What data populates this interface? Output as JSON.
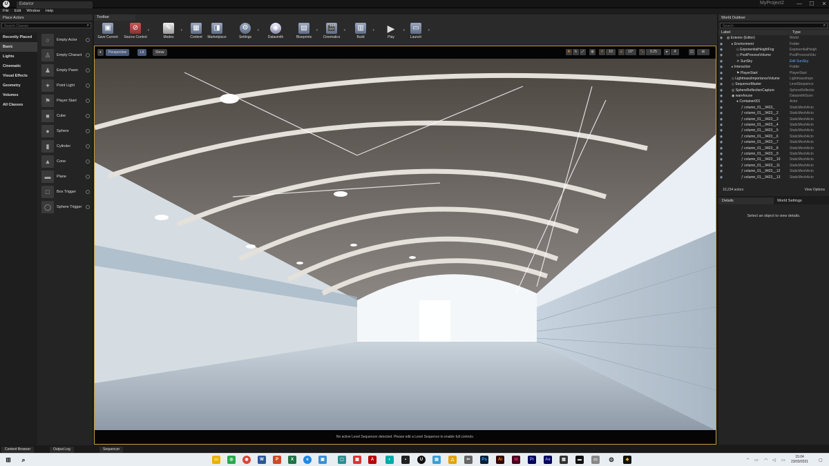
{
  "window": {
    "tab_title": "Exterior",
    "project_name": "MyProject2",
    "min": "—",
    "max": "☐",
    "close": "✕"
  },
  "menu": [
    "File",
    "Edit",
    "Window",
    "Help"
  ],
  "place_actors": {
    "title": "Place Actors",
    "search_placeholder": "Search Classes",
    "categories": [
      "Recently Placed",
      "Basic",
      "Lights",
      "Cinematic",
      "Visual Effects",
      "Geometry",
      "Volumes",
      "All Classes"
    ],
    "items": [
      "Empty Actor",
      "Empty Charact",
      "Empty Pawn",
      "Point Light",
      "Player Start",
      "Cube",
      "Sphere",
      "Cylinder",
      "Cone",
      "Plane",
      "Box Trigger",
      "Sphere Trigger"
    ]
  },
  "toolbar": {
    "title": "Toolbar",
    "buttons": [
      "Save Current",
      "Source Control",
      "Modes",
      "Content",
      "Marketplace",
      "Settings",
      "Datasmith",
      "Blueprints",
      "Cinematics",
      "Build",
      "Play",
      "Launch"
    ]
  },
  "viewport": {
    "perspective": "Perspective",
    "lit": "Lit",
    "show": "Show",
    "grid_snap": "10",
    "rot_snap": "10°",
    "scale_snap": "0.25",
    "cam_speed": "4",
    "footer_msg": "No active Level Sequencer detected. Please edit a Level Sequence to enable full controls."
  },
  "outliner": {
    "title": "World Outliner",
    "search_placeholder": "Search",
    "col_label": "Label",
    "col_type": "Type",
    "rows": [
      {
        "label": "Exterior (Editor)",
        "type": "World",
        "indent": 0
      },
      {
        "label": "Environment",
        "type": "Folder",
        "indent": 1
      },
      {
        "label": "ExponentialHeightFog",
        "type": "ExponentialHeigh",
        "indent": 2
      },
      {
        "label": "PostProcessVolume",
        "type": "PostProcessVolu",
        "indent": 2
      },
      {
        "label": "SunSky",
        "type": "Edit SunSky",
        "indent": 2
      },
      {
        "label": "Interaction",
        "type": "Folder",
        "indent": 1
      },
      {
        "label": "PlayerStart",
        "type": "PlayerStart",
        "indent": 2
      },
      {
        "label": "LightmassImportanceVolume",
        "type": "LightmassImpo",
        "indent": 1
      },
      {
        "label": "SequenceMaster",
        "type": "LevelSequence",
        "indent": 1
      },
      {
        "label": "SphereReflectionCapture",
        "type": "SphereReflectio",
        "indent": 1
      },
      {
        "label": "warehouse",
        "type": "DatasmithScen",
        "indent": 1
      },
      {
        "label": "Container001",
        "type": "Actor",
        "indent": 2
      },
      {
        "label": "column_01__9423_",
        "type": "StaticMeshActo",
        "indent": 3
      },
      {
        "label": "column_01__9423__2",
        "type": "StaticMeshActo",
        "indent": 3
      },
      {
        "label": "column_01__9423__3",
        "type": "StaticMeshActo",
        "indent": 3
      },
      {
        "label": "column_01__9423__4",
        "type": "StaticMeshActo",
        "indent": 3
      },
      {
        "label": "column_01__9423__5",
        "type": "StaticMeshActo",
        "indent": 3
      },
      {
        "label": "column_01__9423__6",
        "type": "StaticMeshActo",
        "indent": 3
      },
      {
        "label": "column_01__9423__7",
        "type": "StaticMeshActo",
        "indent": 3
      },
      {
        "label": "column_01__9423__8",
        "type": "StaticMeshActo",
        "indent": 3
      },
      {
        "label": "column_01__9423__9",
        "type": "StaticMeshActo",
        "indent": 3
      },
      {
        "label": "column_01__9423__10",
        "type": "StaticMeshActo",
        "indent": 3
      },
      {
        "label": "column_01__9423__11",
        "type": "StaticMeshActo",
        "indent": 3
      },
      {
        "label": "column_01__9423__12",
        "type": "StaticMeshActo",
        "indent": 3
      },
      {
        "label": "column_01__9423__13",
        "type": "StaticMeshActo",
        "indent": 3
      }
    ],
    "actor_count": "10,234 actors",
    "view_options": "View Options"
  },
  "details": {
    "tab_details": "Details",
    "tab_world": "World Settings",
    "empty_msg": "Select an object to view details."
  },
  "bottom_tabs": [
    "Content Browser",
    "Output Log",
    "Sequencer"
  ],
  "taskbar": {
    "time": "15:04",
    "date": "23/03/2021"
  }
}
